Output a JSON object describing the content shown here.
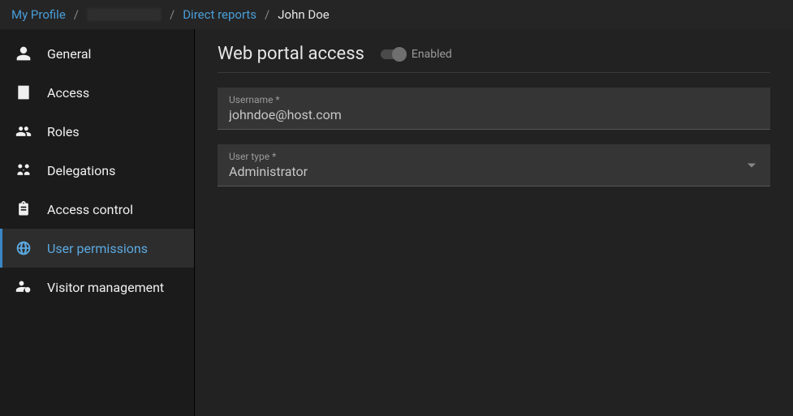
{
  "breadcrumb": {
    "item0": "My Profile",
    "item2": "Direct reports",
    "item3": "John Doe"
  },
  "sidebar": {
    "items": [
      {
        "label": "General"
      },
      {
        "label": "Access"
      },
      {
        "label": "Roles"
      },
      {
        "label": "Delegations"
      },
      {
        "label": "Access control"
      },
      {
        "label": "User permissions"
      },
      {
        "label": "Visitor management"
      }
    ]
  },
  "main": {
    "section_title": "Web portal access",
    "toggle_label": "Enabled",
    "username": {
      "label": "Username *",
      "value": "johndoe@host.com"
    },
    "usertype": {
      "label": "User type *",
      "value": "Administrator"
    }
  }
}
